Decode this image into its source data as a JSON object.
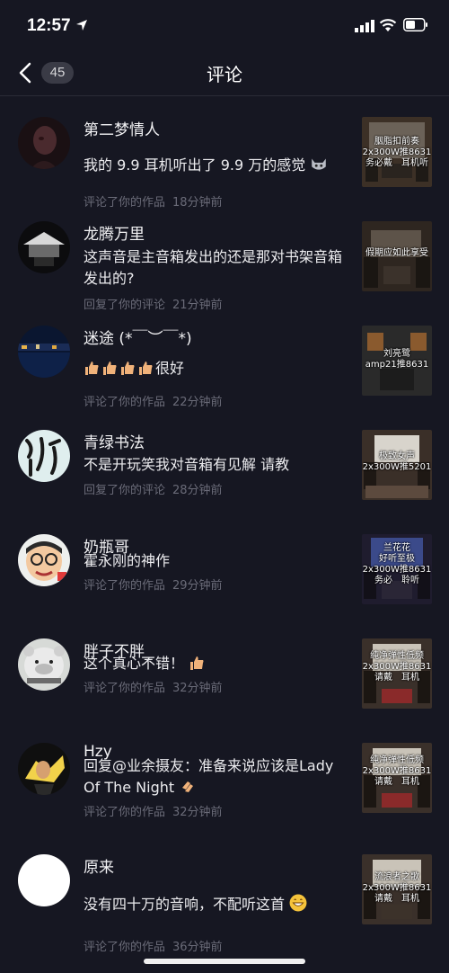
{
  "status": {
    "time": "12:57"
  },
  "nav": {
    "badge": "45",
    "title": "评论"
  },
  "comments": [
    {
      "name": "第二梦情人",
      "text": "我的 9.9 耳机听出了 9.9 万的感觉",
      "action": "评论了你的作品",
      "time": "18分钟前",
      "thumb": "胭脂扣前奏\n2x300W推8631\n务必戴　耳机听",
      "avatar": "dark-portrait"
    },
    {
      "name": "龙腾万里",
      "text": "这声音是主音箱发出的还是那对书架音箱发出的?",
      "action": "回复了你的评论",
      "time": "21分钟前",
      "thumb": "假期应如此享受",
      "avatar": "dark-building"
    },
    {
      "name": "迷途 (*￣︶￣*)",
      "text": "很好",
      "action": "评论了你的作品",
      "time": "22分钟前",
      "thumb": "刘亮鹭\namp21推8631",
      "avatar": "night-city"
    },
    {
      "name": "青绿书法",
      "text": "不是开玩笑我对音箱有见解 请教",
      "action": "回复了你的评论",
      "time": "28分钟前",
      "thumb": "极致女声\n2x300W推5201",
      "avatar": "calligraphy"
    },
    {
      "name": "奶瓶哥",
      "text": "霍永刚的神作",
      "action": "评论了你的作品",
      "time": "29分钟前",
      "thumb": "兰花花\n好听至极\n2x300W推8631\n务必　聆听",
      "avatar": "cartoon-face"
    },
    {
      "name": "胖子不胖_",
      "text": "这个真心不错！",
      "action": "评论了你的作品",
      "time": "32分钟前",
      "thumb": "纯净弹性低频\n2x300W推8631\n请戴　耳机",
      "avatar": "bear"
    },
    {
      "name": "Hzy",
      "text": "回复@业余摄友：准备来说应该是Lady Of The Night",
      "action": "评论了你的作品",
      "time": "32分钟前",
      "thumb": "纯净弹性低频\n2x300W推8631\n请戴　耳机",
      "avatar": "dark-figure"
    },
    {
      "name": "原来",
      "text": "没有四十万的音响，不配听这首",
      "action": "评论了你的作品",
      "time": "36分钟前",
      "thumb": "流浪者之歌\n2x300W推8631\n请戴　耳机",
      "avatar": "white"
    }
  ]
}
